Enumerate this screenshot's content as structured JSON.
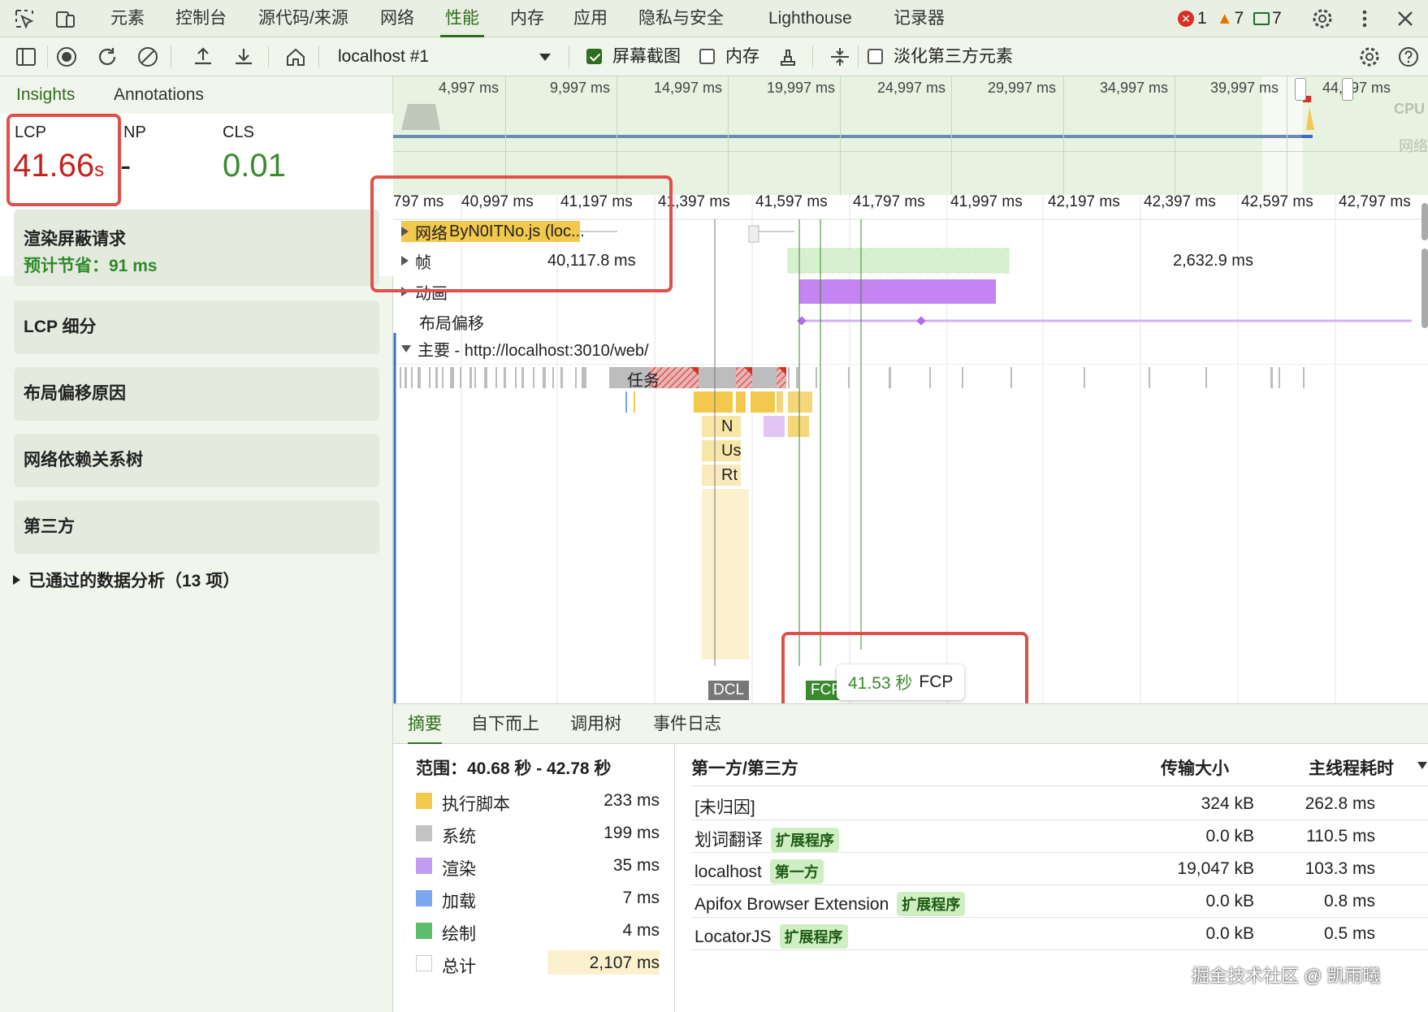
{
  "topbar": {
    "tabs": [
      "元素",
      "控制台",
      "源代码/来源",
      "网络",
      "性能",
      "内存",
      "应用",
      "隐私与安全",
      "Lighthouse",
      "记录器"
    ],
    "active_tab": "性能",
    "errors": "1",
    "warnings": "7",
    "messages": "7"
  },
  "toolbar": {
    "target": "localhost #1",
    "screenshot_label": "屏幕截图",
    "memory_label": "内存",
    "dim_third_party_label": "淡化第三方元素"
  },
  "left": {
    "tabs": [
      "Insights",
      "Annotations"
    ],
    "metrics": {
      "lcp_label": "LCP",
      "lcp_value": "41.66",
      "lcp_unit": "s",
      "inp_label": "NP",
      "inp_value": "-",
      "cls_label": "CLS",
      "cls_value": "0.01"
    },
    "insights": [
      {
        "title": "渲染屏蔽请求",
        "subtitle": "预计节省：91 ms"
      },
      {
        "title": "LCP 细分"
      },
      {
        "title": "布局偏移原因"
      },
      {
        "title": "网络依赖关系树"
      },
      {
        "title": "第三方"
      }
    ],
    "passed": "已通过的数据分析（13 项）"
  },
  "overview": {
    "ticks": [
      "4,997 ms",
      "9,997 ms",
      "14,997 ms",
      "19,997 ms",
      "24,997 ms",
      "29,997 ms",
      "34,997 ms",
      "39,997 ms",
      "44,997 ms"
    ],
    "cpu_label": "CPU",
    "net_label": "网络"
  },
  "flame": {
    "ticks": [
      "797 ms",
      "40,997 ms",
      "41,197 ms",
      "41,397 ms",
      "41,597 ms",
      "41,797 ms",
      "41,997 ms",
      "42,197 ms",
      "42,397 ms",
      "42,597 ms",
      "42,797 ms"
    ],
    "network_track": "网络",
    "network_item": "ByN0ITNo.js (loc...",
    "frames_track": "帧",
    "frames_value_1": "40,117.8 ms",
    "frames_value_2": "2,632.9 ms",
    "animation_track": "动画",
    "layout_shift_track": "布局偏移",
    "main_track": "主要 - http://localhost:3010/web/",
    "task_label": "任务",
    "sub_labels": [
      "N",
      "Us",
      "Rt"
    ],
    "dcl_marker": "DCL",
    "fcp_marker": "FCP",
    "tooltip_time": "41.53 秒",
    "tooltip_label": "FCP"
  },
  "bottom": {
    "tabs": [
      "摘要",
      "自下而上",
      "调用树",
      "事件日志"
    ],
    "active_tab": "摘要",
    "range": "范围：40.68 秒 - 42.78 秒",
    "summary": [
      {
        "label": "执行脚本",
        "value": "233 ms",
        "color": "#f2c94c"
      },
      {
        "label": "系统",
        "value": "199 ms",
        "color": "#c4c4c4"
      },
      {
        "label": "渲染",
        "value": "35 ms",
        "color": "#c39bf0"
      },
      {
        "label": "加载",
        "value": "7 ms",
        "color": "#7ba7f0"
      },
      {
        "label": "绘制",
        "value": "4 ms",
        "color": "#5bbd6a"
      },
      {
        "label": "总计",
        "value": "2,107 ms",
        "color": "#ffffff"
      }
    ],
    "thirdparty_headers": [
      "第一方/第三方",
      "传输大小",
      "主线程耗时"
    ],
    "thirdparty_rows": [
      {
        "name": "[未归因]",
        "badge": "",
        "size": "324 kB",
        "time": "262.8 ms"
      },
      {
        "name": "划词翻译",
        "badge": "扩展程序",
        "size": "0.0 kB",
        "time": "110.5 ms"
      },
      {
        "name": "localhost",
        "badge": "第一方",
        "size": "19,047 kB",
        "time": "103.3 ms"
      },
      {
        "name": "Apifox Browser Extension",
        "badge": "扩展程序",
        "size": "0.0 kB",
        "time": "0.8 ms"
      },
      {
        "name": "LocatorJS",
        "badge": "扩展程序",
        "size": "0.0 kB",
        "time": "0.5 ms"
      }
    ],
    "watermark": "掘金技术社区 @ 凯雨曦"
  }
}
